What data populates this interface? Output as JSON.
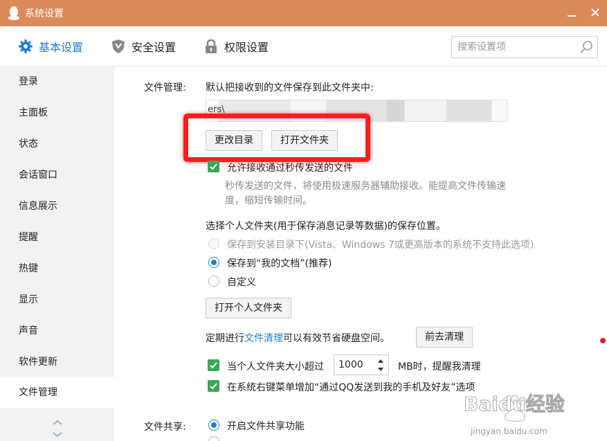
{
  "window": {
    "title": "系统设置"
  },
  "tabs": [
    {
      "label": "基本设置",
      "icon": "gear-icon",
      "active": true
    },
    {
      "label": "安全设置",
      "icon": "shield-icon",
      "active": false
    },
    {
      "label": "权限设置",
      "icon": "lock-icon",
      "active": false
    }
  ],
  "search": {
    "placeholder": "搜索设置项"
  },
  "sidebar": {
    "items": [
      {
        "label": "登录"
      },
      {
        "label": "主面板"
      },
      {
        "label": "状态"
      },
      {
        "label": "会话窗口"
      },
      {
        "label": "信息展示"
      },
      {
        "label": "提醒"
      },
      {
        "label": "热键"
      },
      {
        "label": "显示"
      },
      {
        "label": "声音"
      },
      {
        "label": "软件更新"
      },
      {
        "label": "文件管理",
        "active": true
      }
    ]
  },
  "file_management": {
    "section_label": "文件管理:",
    "save_desc": "默认把接收到的文件保存到此文件夹中:",
    "path_value": "ers\\",
    "change_dir_button": "更改目录",
    "open_folder_button": "打开文件夹",
    "allow_flash_label": "允许接收通过秒传发送的文件",
    "allow_flash_desc_1": "秒传发送的文件，将使用极速服务器辅助接收。能提高文件传输速",
    "allow_flash_desc_2": "度，缩短传输时间。",
    "personal_folder_desc": "选择个人文件夹(用于保存消息记录等数据)的保存位置。",
    "radio_install": "保存到安装目录下(Vista、Windows 7或更高版本的系统不支持此选项)",
    "radio_mydocs": "保存到“我的文档”(推荐)",
    "radio_custom": "自定义",
    "open_personal_button": "打开个人文件夹",
    "cleanup_text_before": "定期进行",
    "cleanup_link": "文件清理",
    "cleanup_text_after": "可以有效节省硬盘空间。",
    "cleanup_button": "前去清理",
    "size_remind_before": "当个人文件夹大小超过",
    "size_value": "1000",
    "size_remind_after": "MB时，提醒我清理",
    "context_menu_label": "在系统右键菜单增加“通过QQ发送到我的手机及好友”选项"
  },
  "file_sharing": {
    "section_label": "文件共享:",
    "enable_label": "开启文件共享功能"
  },
  "watermark": {
    "brand": "Baidu经验",
    "url": "jingyan.baidu.com"
  },
  "colors": {
    "titlebar": "#db8a5a",
    "accent": "#1e7fd1",
    "checkbox": "#3aa757",
    "highlight": "#ff1d1d"
  }
}
